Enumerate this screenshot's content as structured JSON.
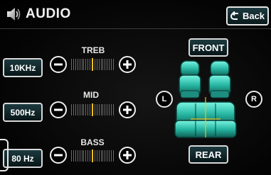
{
  "header": {
    "title": "AUDIO",
    "back_label": "Back"
  },
  "tone": [
    {
      "name": "TREB",
      "value": "10KHz",
      "level": 0
    },
    {
      "name": "MID",
      "value": "500Hz",
      "level": 0
    },
    {
      "name": "BASS",
      "value": "80 Hz",
      "level": 0
    }
  ],
  "fader": {
    "front_label": "FRONT",
    "rear_label": "REAR",
    "left_label": "L",
    "right_label": "R"
  },
  "colors": {
    "accent": "#f0c020",
    "seat_glow": "#35e0c8",
    "button_bg": "#1c3a3f"
  },
  "icons": [
    "speaker-icon",
    "back-arrow-icon",
    "minus-icon",
    "plus-icon"
  ]
}
